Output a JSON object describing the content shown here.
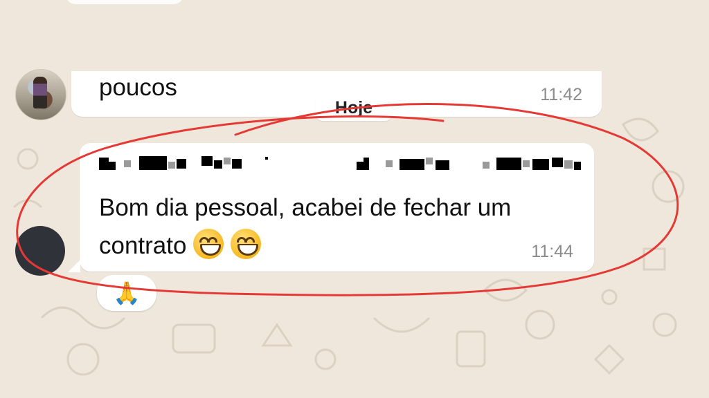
{
  "previous_message": {
    "text": "poucos",
    "time": "11:42"
  },
  "date_separator": "Hoje",
  "message": {
    "text": "Bom dia pessoal, acabei de fechar um contrato",
    "emojis": [
      "😄",
      "😄"
    ],
    "time": "11:44"
  },
  "reaction": {
    "emoji": "🙏"
  },
  "colors": {
    "chat_background": "#efe7dc",
    "bubble": "#ffffff",
    "timestamp": "#8b8b8b",
    "annotation_circle": "#e53935"
  },
  "icons": [
    "avatar-photo",
    "avatar-redacted",
    "smile-emoji",
    "pray-emoji"
  ]
}
